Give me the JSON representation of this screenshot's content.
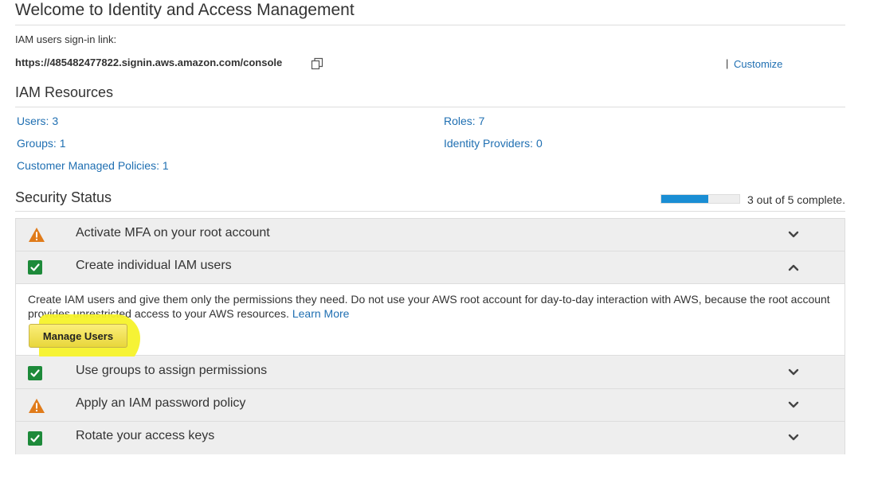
{
  "header": {
    "title": "Welcome to Identity and Access Management",
    "signin_label": "IAM users sign-in link:",
    "signin_url": "https://485482477822.signin.aws.amazon.com/console",
    "copy_icon": "copy-icon",
    "customize_separator": "|",
    "customize_label": "Customize"
  },
  "resources": {
    "title": "IAM Resources",
    "items": [
      {
        "label": "Users: 3"
      },
      {
        "label": "Roles: 7"
      },
      {
        "label": "Groups: 1"
      },
      {
        "label": "Identity Providers: 0"
      },
      {
        "label": "Customer Managed Policies: 1"
      }
    ]
  },
  "security": {
    "title": "Security Status",
    "progress_fraction": 0.6,
    "progress_text": "3 out of 5 complete.",
    "items": [
      {
        "label": "Activate MFA on your root account",
        "status": "warning",
        "icon": "warning-icon",
        "expanded": false
      },
      {
        "label": "Create individual IAM users",
        "status": "complete",
        "icon": "check-icon",
        "expanded": true
      },
      {
        "label": "Use groups to assign permissions",
        "status": "complete",
        "icon": "check-icon",
        "expanded": false
      },
      {
        "label": "Apply an IAM password policy",
        "status": "warning",
        "icon": "warning-icon",
        "expanded": false
      },
      {
        "label": "Rotate your access keys",
        "status": "complete",
        "icon": "check-icon",
        "expanded": false
      }
    ],
    "expanded_panel": {
      "text": "Create IAM users and give them only the permissions they need. Do not use your AWS root account for day-to-day interaction with AWS, because the root account provides unrestricted access to your AWS resources.",
      "learn_more": "Learn More",
      "button_label": "Manage Users"
    }
  },
  "colors": {
    "link": "#1f6fb2",
    "warning": "#e07b1a",
    "success": "#1d8a3a",
    "progress": "#1a8ed4",
    "highlight": "#f6f22a"
  }
}
